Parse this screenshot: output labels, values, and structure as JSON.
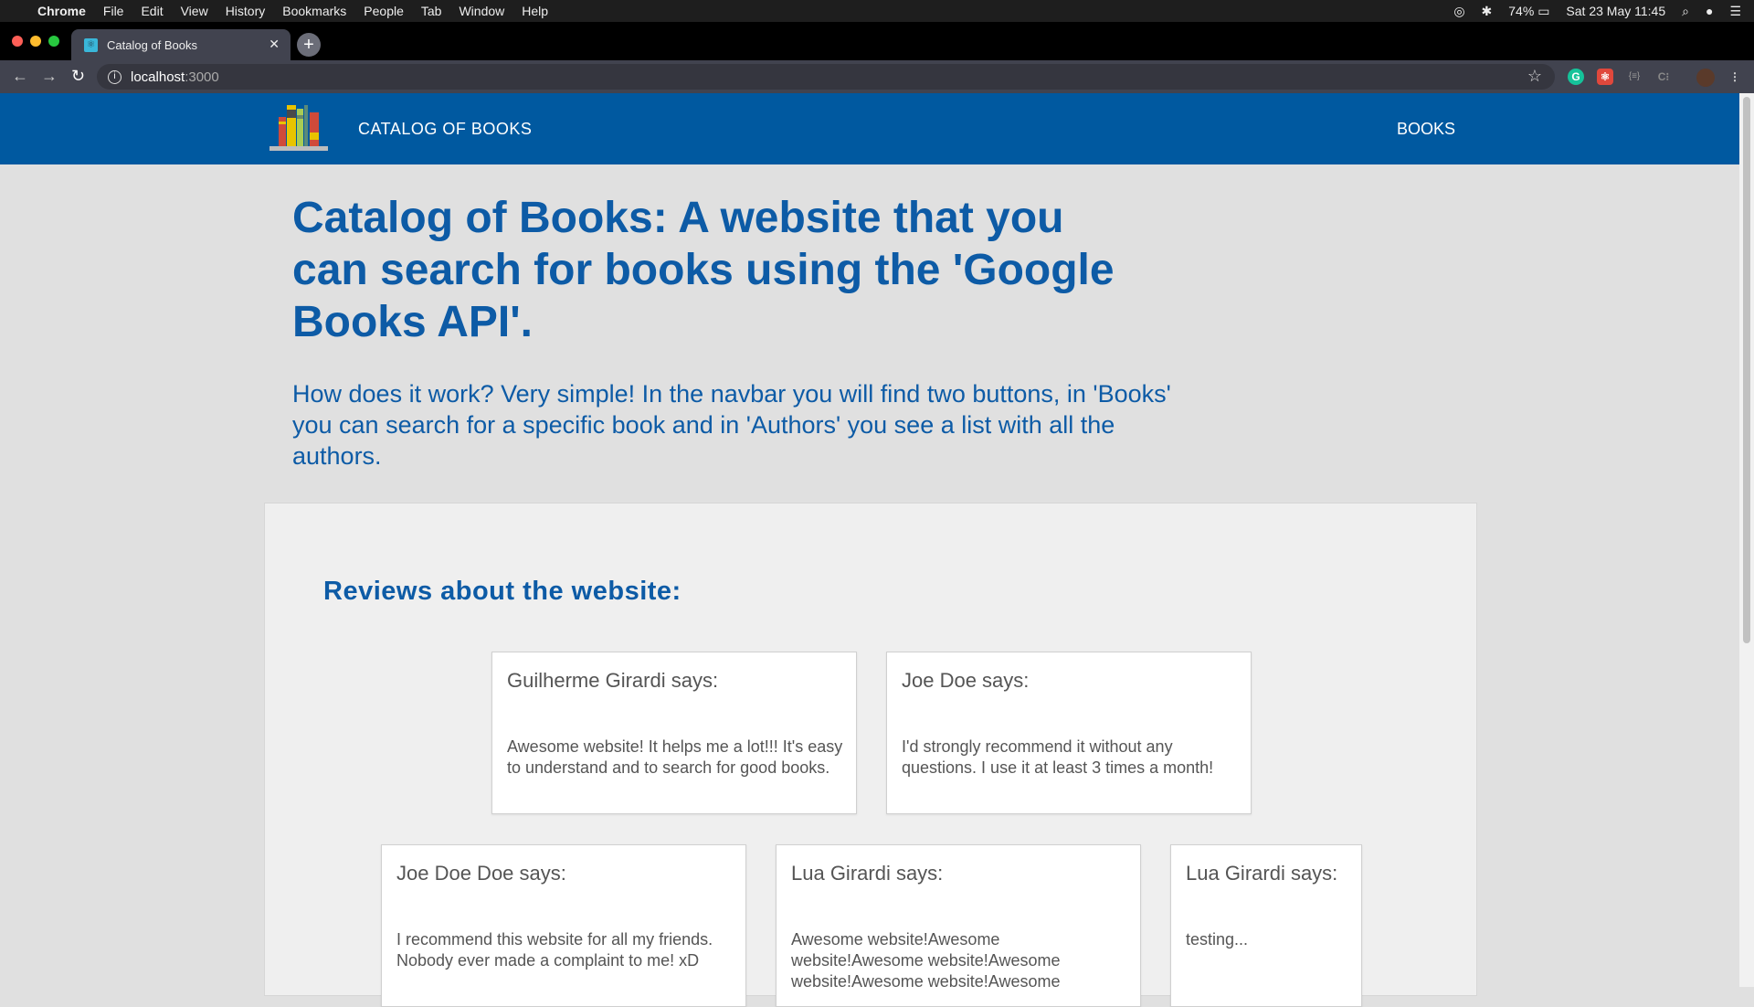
{
  "menubar": {
    "app": "Chrome",
    "items": [
      "File",
      "Edit",
      "View",
      "History",
      "Bookmarks",
      "People",
      "Tab",
      "Window",
      "Help"
    ],
    "battery": "74%",
    "datetime": "Sat 23 May  11:45"
  },
  "browser": {
    "tab_title": "Catalog of Books",
    "url_host": "localhost",
    "url_port": ":3000"
  },
  "navbar": {
    "brand": "CATALOG OF BOOKS",
    "books_link": "BOOKS"
  },
  "hero": {
    "title": "Catalog of Books: A website that you can search for books using the 'Google Books API'.",
    "text": "How does it work? Very simple! In the navbar you will find two buttons, in 'Books' you can search for a specific book and in 'Authors' you see a list with all the authors."
  },
  "reviews": {
    "title": "Reviews about the website:",
    "items": [
      {
        "author": "Guilherme Girardi says:",
        "text": "Awesome website! It helps me a lot!!! It's easy to understand and to search for good books."
      },
      {
        "author": "Joe Doe says:",
        "text": "I'd strongly recommend it without any questions. I use it at least 3 times a month!"
      },
      {
        "author": "Joe Doe Doe says:",
        "text": "I recommend this website for all my friends. Nobody ever made a complaint to me! xD"
      },
      {
        "author": "Lua Girardi says:",
        "text": "Awesome website!Awesome website!Awesome website!Awesome website!Awesome website!Awesome"
      },
      {
        "author": "Lua Girardi says:",
        "text": "testing..."
      }
    ]
  },
  "colors": {
    "navbar": "#0059a0",
    "heading": "#0d5ba6"
  }
}
